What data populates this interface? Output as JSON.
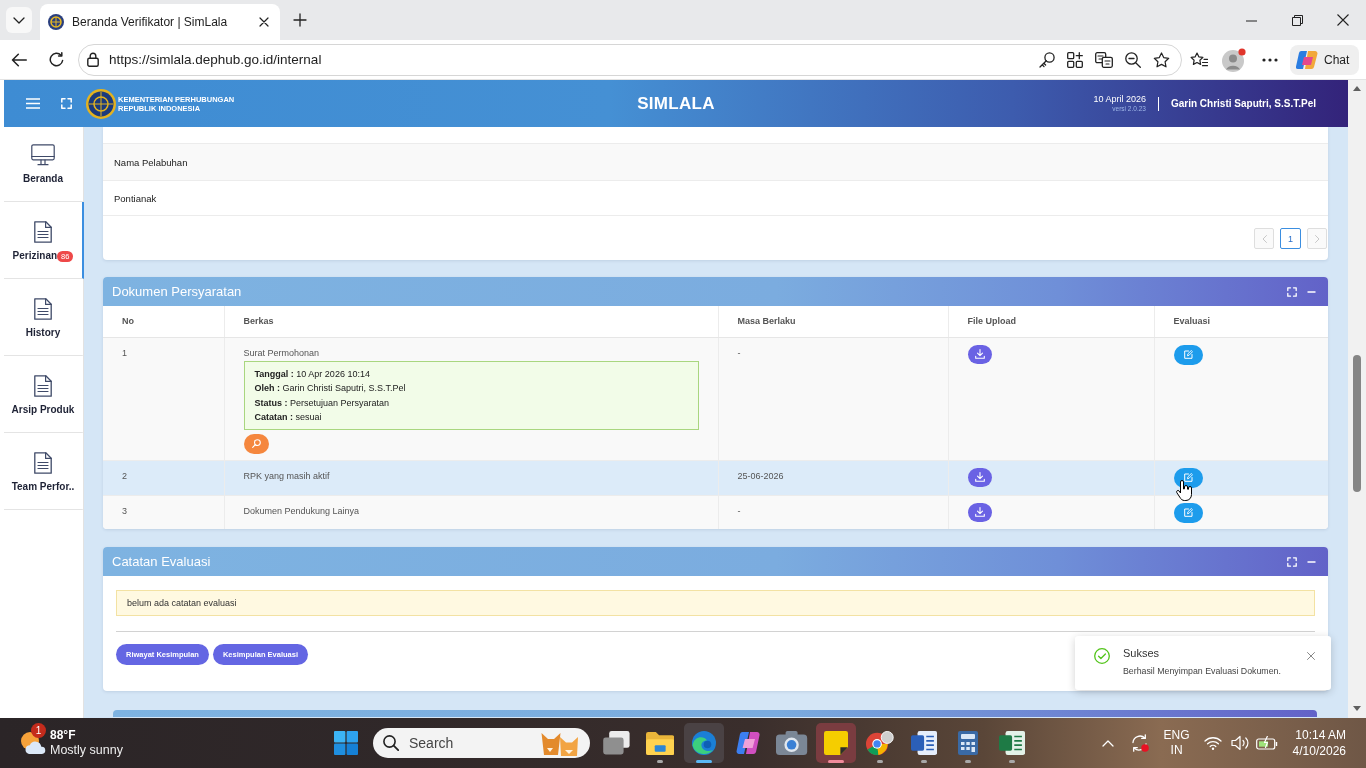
{
  "browser": {
    "tabs": [
      {
        "title": "Beranda Verifikator | SimLala",
        "selected": true
      }
    ],
    "url": "https://simlala.dephub.go.id/internal",
    "profile_notification": true,
    "chat_label": "Chat"
  },
  "header": {
    "org_name": [
      "KEMENTERIAN PERHUBUNGAN",
      "REPUBLIK INDONESIA"
    ],
    "app_title": "SIMLALA",
    "date": "10 April 2026",
    "version": "versi 2.0.23",
    "user_name": "Garin Christi Saputri, S.S.T.Pel"
  },
  "sidebar": {
    "items": [
      {
        "label": "Beranda",
        "kind": "monitor",
        "selected": false
      },
      {
        "label": "Perizinan",
        "kind": "document",
        "selected": true,
        "badge": "86"
      },
      {
        "label": "History",
        "kind": "document",
        "selected": false
      },
      {
        "label": "Arsip Produk",
        "kind": "document",
        "selected": false
      },
      {
        "label": "Team Perfor..",
        "kind": "document",
        "selected": false
      }
    ]
  },
  "port_table": {
    "rows": [
      "Nama Pelabuhan",
      "Pontianak"
    ],
    "pagination": {
      "prev_disabled": true,
      "pages": [
        {
          "label": "1",
          "selected": true
        }
      ],
      "next_disabled": true
    }
  },
  "documents_panel": {
    "title": "Dokumen Persyaratan",
    "columns": [
      "No",
      "Berkas",
      "Masa Berlaku",
      "File Upload",
      "Evaluasi"
    ],
    "rows": [
      {
        "no": "1",
        "file": "Surat Permohonan",
        "valid_until": "-",
        "hovered": false,
        "review": [
          "**Tanggal :** 10 Apr 2026 10:14",
          "**Oleh :** Garin Christi Saputri, S.S.T.Pel",
          "**Status :** Persetujuan Persyaratan",
          "**Catatan :** sesuai"
        ]
      },
      {
        "no": "2",
        "file": "RPK yang masih aktif",
        "valid_until": "25-06-2026",
        "hovered": true
      },
      {
        "no": "3",
        "file": "Dokumen Pendukung Lainya",
        "valid_until": "-",
        "hovered": false
      }
    ]
  },
  "evaluation_panel": {
    "title": "Catatan Evaluasi",
    "notice": "belum ada catatan evaluasi",
    "buttons": [
      "Riwayat Kesimpulan",
      "Kesimpulan Evaluasi"
    ]
  },
  "toast": {
    "kind": "success",
    "title": "Sukses",
    "message": "Berhasil Menyimpan Evaluasi Dokumen."
  },
  "taskbar": {
    "weather": {
      "badge": "1",
      "temperature": "88°F",
      "condition": "Mostly sunny"
    },
    "search": {
      "placeholder": "Search"
    },
    "apps": [
      {
        "kind": "task-view",
        "running": false,
        "selected": false,
        "attention": false
      },
      {
        "kind": "folder",
        "running": true,
        "selected": false,
        "attention": false
      },
      {
        "kind": "edge",
        "running": true,
        "selected": true,
        "attention": false
      },
      {
        "kind": "copilot",
        "running": false,
        "selected": false,
        "attention": false
      },
      {
        "kind": "camera",
        "running": false,
        "selected": false,
        "attention": false
      },
      {
        "kind": "sticky-notes",
        "running": true,
        "selected": false,
        "attention": true
      },
      {
        "kind": "chrome",
        "running": true,
        "selected": false,
        "attention": false
      },
      {
        "kind": "word",
        "running": true,
        "selected": false,
        "attention": false
      },
      {
        "kind": "calculator",
        "running": true,
        "selected": false,
        "attention": false
      },
      {
        "kind": "excel",
        "running": true,
        "selected": false,
        "attention": false
      }
    ],
    "tray": {
      "language": "ENG",
      "region": "IN",
      "time": "10:14 AM",
      "date": "4/10/2026"
    }
  }
}
